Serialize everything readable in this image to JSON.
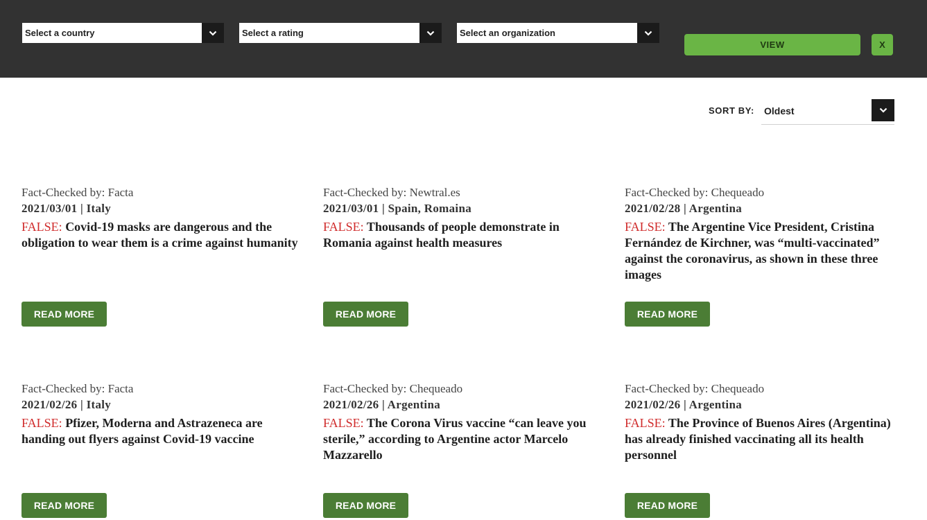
{
  "filters": {
    "country_placeholder": "Select a country",
    "rating_placeholder": "Select a rating",
    "organization_placeholder": "Select an organization",
    "view_label": "VIEW",
    "clear_label": "X"
  },
  "sort": {
    "label": "SORT BY:",
    "value": "Oldest"
  },
  "colors": {
    "bar_bg": "#323232",
    "accent_green": "#6ab545",
    "button_green": "#4b7d35",
    "false_red": "#d02b2b"
  },
  "icons": {
    "dropdown": "chevron-down-icon"
  },
  "cards": [
    {
      "checked_by": "Fact-Checked by: Facta",
      "meta": "2021/03/01 | Italy",
      "rating": "FALSE:",
      "headline": "Covid-19 masks are dangerous and the obligation to wear them is a crime against humanity",
      "button": "READ MORE"
    },
    {
      "checked_by": "Fact-Checked by: Newtral.es",
      "meta": "2021/03/01 | Spain, Romaina",
      "rating": "FALSE:",
      "headline": "Thousands of people demonstrate in Romania against health measures",
      "button": "READ MORE"
    },
    {
      "checked_by": "Fact-Checked by: Chequeado",
      "meta": "2021/02/28 | Argentina",
      "rating": "FALSE:",
      "headline": "The Argentine Vice President, Cristina Fernández de Kirchner, was “multi-vaccinated” against the coronavirus, as shown in these three images",
      "button": "READ MORE"
    },
    {
      "checked_by": "Fact-Checked by: Facta",
      "meta": "2021/02/26 | Italy",
      "rating": "FALSE:",
      "headline": "Pfizer, Moderna and Astrazeneca are handing out flyers against Covid-19 vaccine",
      "button": "READ MORE"
    },
    {
      "checked_by": "Fact-Checked by: Chequeado",
      "meta": "2021/02/26 | Argentina",
      "rating": "FALSE:",
      "headline": "The Corona Virus vaccine “can leave you sterile,” according to Argentine actor Marcelo Mazzarello",
      "button": "READ MORE"
    },
    {
      "checked_by": "Fact-Checked by: Chequeado",
      "meta": "2021/02/26 | Argentina",
      "rating": "FALSE:",
      "headline": "The Province of Buenos Aires (Argentina) has already finished vaccinating all its health personnel",
      "button": "READ MORE"
    }
  ]
}
